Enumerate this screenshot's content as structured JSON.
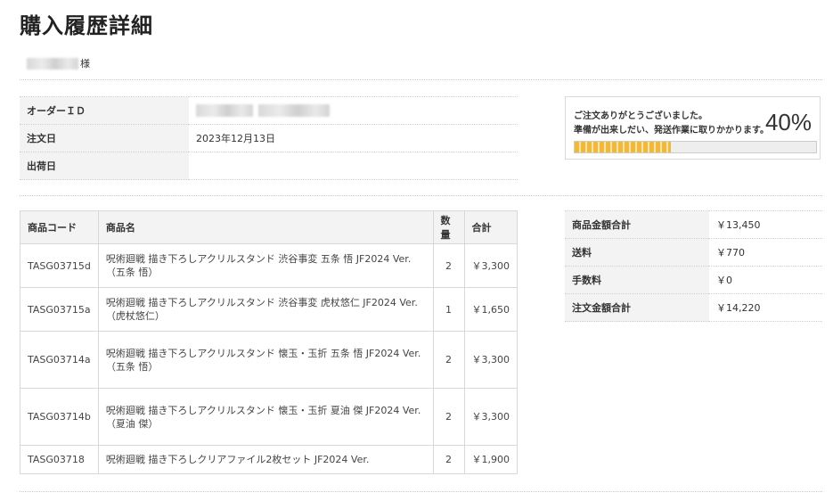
{
  "page": {
    "title": "購入履歴詳細"
  },
  "customer": {
    "suffix": "様"
  },
  "order_info": {
    "order_id_label": "オーダーＩＤ",
    "order_date_label": "注文日",
    "order_date": "2023年12月13日",
    "ship_date_label": "出荷日",
    "ship_date": ""
  },
  "progress": {
    "line1": "ご注文ありがとうございました。",
    "line2": "準備が出来しだい、発送作業に取りかかります。",
    "percent_text": "40%",
    "value": 0.4,
    "bar_color": "#f2b83a"
  },
  "items_table": {
    "headers": {
      "code": "商品コード",
      "name": "商品名",
      "qty": "数量",
      "total": "合計"
    },
    "rows": [
      {
        "code": "TASG03715d",
        "name": "呪術廻戦 描き下ろしアクリルスタンド 渋谷事変 五条 悟 JF2024 Ver.",
        "sub": "（五条 悟）",
        "qty": "2",
        "total": "￥3,300"
      },
      {
        "code": "TASG03715a",
        "name": "呪術廻戦 描き下ろしアクリルスタンド 渋谷事変 虎杖悠仁 JF2024 Ver.",
        "sub": "（虎杖悠仁）",
        "qty": "1",
        "total": "￥1,650"
      },
      {
        "code": "TASG03714a",
        "name": "呪術廻戦 描き下ろしアクリルスタンド 懐玉・玉折 五条 悟 JF2024 Ver.",
        "sub": "（五条 悟）",
        "qty": "2",
        "total": "￥3,300"
      },
      {
        "code": "TASG03714b",
        "name": "呪術廻戦 描き下ろしアクリルスタンド 懐玉・玉折 夏油 傑 JF2024 Ver.",
        "sub": "（夏油 傑）",
        "qty": "2",
        "total": "￥3,300"
      },
      {
        "code": "TASG03718",
        "name": "呪術廻戦 描き下ろしクリアファイル2枚セット JF2024 Ver.",
        "sub": "",
        "qty": "2",
        "total": "￥1,900"
      }
    ]
  },
  "totals": {
    "subtotal_label": "商品金額合計",
    "subtotal": "￥13,450",
    "shipping_label": "送料",
    "shipping": "￥770",
    "fee_label": "手数料",
    "fee": "￥0",
    "grand_total_label": "注文金額合計",
    "grand_total": "￥14,220"
  }
}
